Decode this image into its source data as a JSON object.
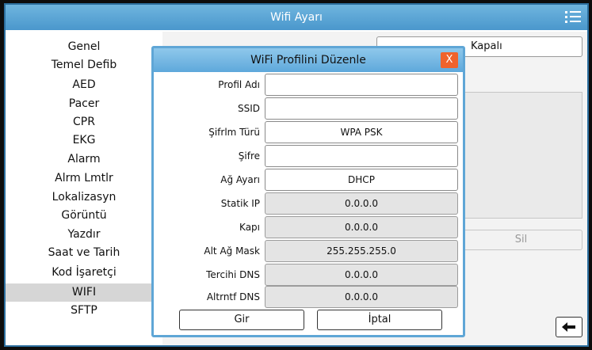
{
  "window": {
    "title": "Wifi Ayarı"
  },
  "sidebar": {
    "items": [
      {
        "label": "Genel"
      },
      {
        "label": "Temel Defib"
      },
      {
        "label": "AED"
      },
      {
        "label": "Pacer"
      },
      {
        "label": "CPR"
      },
      {
        "label": "EKG"
      },
      {
        "label": "Alarm"
      },
      {
        "label": "Alrm Lmtlr"
      },
      {
        "label": "Lokalizasyn"
      },
      {
        "label": "Görüntü"
      },
      {
        "label": "Yazdır"
      },
      {
        "label": "Saat ve Tarih"
      },
      {
        "label": "Kod İşaretçi"
      },
      {
        "label": "WIFI"
      },
      {
        "label": "SFTP"
      }
    ],
    "active_index": 13
  },
  "main": {
    "wifi_state_value": "Kapalı",
    "delete_label": "Sil",
    "back_icon": "arrow-left-icon"
  },
  "dialog": {
    "title": "WiFi Profilini Düzenle",
    "close_label": "X",
    "fields": [
      {
        "label": "Profil Adı",
        "value": "",
        "editable": true
      },
      {
        "label": "SSID",
        "value": "",
        "editable": true
      },
      {
        "label": "Şifrlm Türü",
        "value": "WPA PSK",
        "editable": true
      },
      {
        "label": "Şifre",
        "value": "",
        "editable": true
      },
      {
        "label": "Ağ Ayarı",
        "value": "DHCP",
        "editable": true
      },
      {
        "label": "Statik IP",
        "value": "0.0.0.0",
        "editable": false
      },
      {
        "label": "Kapı",
        "value": "0.0.0.0",
        "editable": false
      },
      {
        "label": "Alt Ağ Mask",
        "value": "255.255.255.0",
        "editable": false
      },
      {
        "label": "Tercihi DNS",
        "value": "0.0.0.0",
        "editable": false
      },
      {
        "label": "Altrntf DNS",
        "value": "0.0.0.0",
        "editable": false
      }
    ],
    "enter_label": "Gir",
    "cancel_label": "İptal"
  },
  "colors": {
    "titlebar": "#4a97cc",
    "dialog_border": "#5fa6d6",
    "close_button": "#f0632c",
    "active_item": "#d6d6d6"
  }
}
